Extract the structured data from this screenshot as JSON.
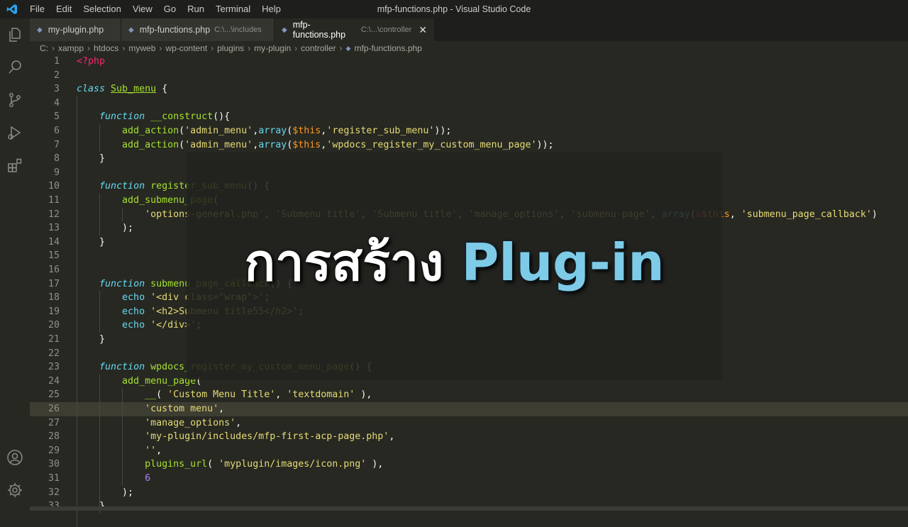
{
  "window": {
    "title": "mfp-functions.php - Visual Studio Code"
  },
  "menu": [
    "File",
    "Edit",
    "Selection",
    "View",
    "Go",
    "Run",
    "Terminal",
    "Help"
  ],
  "tabs": [
    {
      "label": "my-plugin.php",
      "path": "",
      "active": false
    },
    {
      "label": "mfp-functions.php",
      "path": "C:\\...\\includes",
      "active": false
    },
    {
      "label": "mfp-functions.php",
      "path": "C:\\...\\controller",
      "active": true
    }
  ],
  "breadcrumb": [
    "C:",
    "xampp",
    "htdocs",
    "myweb",
    "wp-content",
    "plugins",
    "my-plugin",
    "controller",
    "mfp-functions.php"
  ],
  "overlay": {
    "thai": "การสร้าง",
    "english": "Plug-in"
  },
  "colors": {
    "background": "#272822",
    "keyword": "#66d9ef",
    "string": "#e6db74",
    "function": "#a6e22e",
    "variable": "#fd971f",
    "tag": "#f92672",
    "number": "#ae81ff"
  },
  "editor": {
    "highlighted_line": 26,
    "lines": [
      [
        [
          "kw",
          "<?php"
        ]
      ],
      [],
      [
        [
          "k",
          "class"
        ],
        [
          "t",
          " "
        ],
        [
          "cls",
          "Sub_menu"
        ],
        [
          "t",
          " {"
        ]
      ],
      [],
      [
        [
          "t",
          "    "
        ],
        [
          "k",
          "function"
        ],
        [
          "t",
          " "
        ],
        [
          "fn",
          "__construct"
        ],
        [
          "t",
          "(){"
        ]
      ],
      [
        [
          "t",
          "        "
        ],
        [
          "fn",
          "add_action"
        ],
        [
          "t",
          "("
        ],
        [
          "s",
          "'admin_menu'"
        ],
        [
          "t",
          ","
        ],
        [
          "bi",
          "array"
        ],
        [
          "t",
          "("
        ],
        [
          "var",
          "$this"
        ],
        [
          "t",
          ","
        ],
        [
          "s",
          "'register_sub_menu'"
        ],
        [
          "t",
          "));"
        ]
      ],
      [
        [
          "t",
          "        "
        ],
        [
          "fn",
          "add_action"
        ],
        [
          "t",
          "("
        ],
        [
          "s",
          "'admin_menu'"
        ],
        [
          "t",
          ","
        ],
        [
          "bi",
          "array"
        ],
        [
          "t",
          "("
        ],
        [
          "var",
          "$this"
        ],
        [
          "t",
          ","
        ],
        [
          "s",
          "'wpdocs_register_my_custom_menu_page'"
        ],
        [
          "t",
          "));"
        ]
      ],
      [
        [
          "t",
          "    }"
        ]
      ],
      [],
      [
        [
          "t",
          "    "
        ],
        [
          "k",
          "function"
        ],
        [
          "t",
          " "
        ],
        [
          "fn",
          "register_sub_menu"
        ],
        [
          "t",
          "() {"
        ]
      ],
      [
        [
          "t",
          "        "
        ],
        [
          "fn",
          "add_submenu_page"
        ],
        [
          "t",
          "("
        ]
      ],
      [
        [
          "t",
          "            "
        ],
        [
          "s",
          "'options-general.php'"
        ],
        [
          "t",
          ", "
        ],
        [
          "s",
          "'Submenu title'"
        ],
        [
          "t",
          ", "
        ],
        [
          "s",
          "'Submenu title'"
        ],
        [
          "t",
          ", "
        ],
        [
          "s",
          "'manage_options'"
        ],
        [
          "t",
          ", "
        ],
        [
          "s",
          "'submenu-page'"
        ],
        [
          "t",
          ", "
        ],
        [
          "bi",
          "array"
        ],
        [
          "t",
          "("
        ],
        [
          "kw",
          "&"
        ],
        [
          "var",
          "$this"
        ],
        [
          "t",
          ", "
        ],
        [
          "s",
          "'submenu_page_callback'"
        ],
        [
          "t",
          ")"
        ]
      ],
      [
        [
          "t",
          "        );"
        ]
      ],
      [
        [
          "t",
          "    }"
        ]
      ],
      [],
      [],
      [
        [
          "t",
          "    "
        ],
        [
          "k",
          "function"
        ],
        [
          "t",
          " "
        ],
        [
          "fn",
          "submenu_page_callback"
        ],
        [
          "t",
          "() {"
        ]
      ],
      [
        [
          "t",
          "        "
        ],
        [
          "bi",
          "echo"
        ],
        [
          "t",
          " "
        ],
        [
          "s",
          "'<div class=\"wrap\">'"
        ],
        [
          "t",
          ";"
        ]
      ],
      [
        [
          "t",
          "        "
        ],
        [
          "bi",
          "echo"
        ],
        [
          "t",
          " "
        ],
        [
          "s",
          "'<h2>Submenu title55</h2>'"
        ],
        [
          "t",
          ";"
        ]
      ],
      [
        [
          "t",
          "        "
        ],
        [
          "bi",
          "echo"
        ],
        [
          "t",
          " "
        ],
        [
          "s",
          "'</div>'"
        ],
        [
          "t",
          ";"
        ]
      ],
      [
        [
          "t",
          "    }"
        ]
      ],
      [],
      [
        [
          "t",
          "    "
        ],
        [
          "k",
          "function"
        ],
        [
          "t",
          " "
        ],
        [
          "fn",
          "wpdocs_register_my_custom_menu_page"
        ],
        [
          "t",
          "() {"
        ]
      ],
      [
        [
          "t",
          "        "
        ],
        [
          "fn",
          "add_menu_page"
        ],
        [
          "t",
          "("
        ]
      ],
      [
        [
          "t",
          "            "
        ],
        [
          "fn",
          "__"
        ],
        [
          "t",
          "( "
        ],
        [
          "s",
          "'Custom Menu Title'"
        ],
        [
          "t",
          ", "
        ],
        [
          "s",
          "'textdomain'"
        ],
        [
          "t",
          " ),"
        ]
      ],
      [
        [
          "t",
          "            "
        ],
        [
          "s",
          "'custom menu'"
        ],
        [
          "t",
          ","
        ]
      ],
      [
        [
          "t",
          "            "
        ],
        [
          "s",
          "'manage_options'"
        ],
        [
          "t",
          ","
        ]
      ],
      [
        [
          "t",
          "            "
        ],
        [
          "s",
          "'my-plugin/includes/mfp-first-acp-page.php'"
        ],
        [
          "t",
          ","
        ]
      ],
      [
        [
          "t",
          "            "
        ],
        [
          "s",
          "''"
        ],
        [
          "t",
          ","
        ]
      ],
      [
        [
          "t",
          "            "
        ],
        [
          "fn",
          "plugins_url"
        ],
        [
          "t",
          "( "
        ],
        [
          "s",
          "'myplugin/images/icon.png'"
        ],
        [
          "t",
          " ),"
        ]
      ],
      [
        [
          "t",
          "            "
        ],
        [
          "num",
          "6"
        ]
      ],
      [
        [
          "t",
          "        );"
        ]
      ],
      [
        [
          "t",
          "    }"
        ]
      ]
    ]
  }
}
